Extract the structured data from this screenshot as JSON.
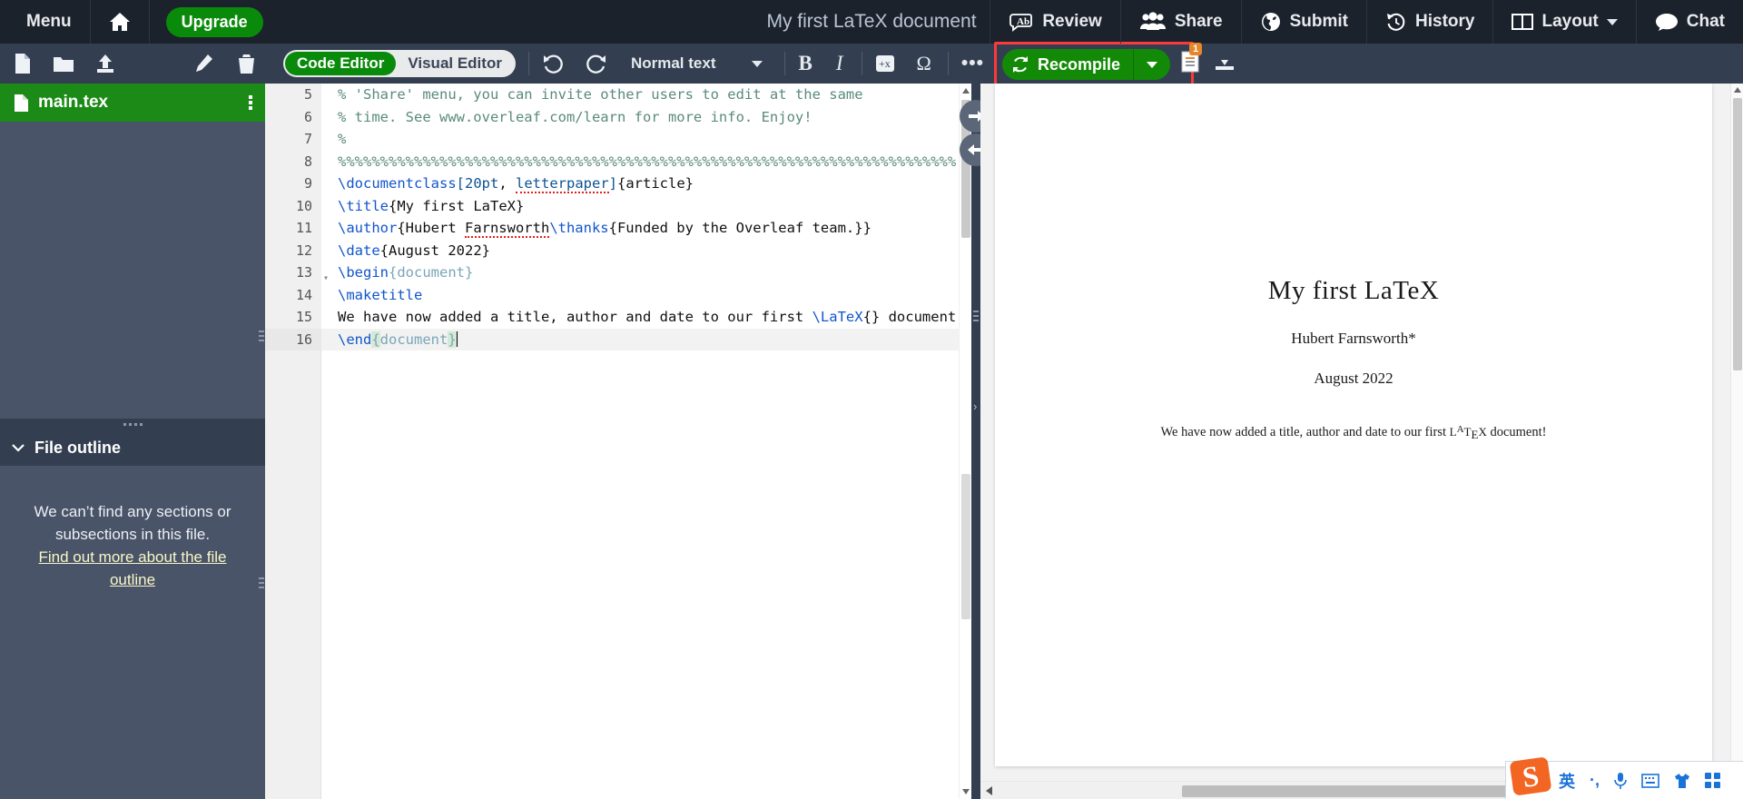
{
  "topbar": {
    "logo_icon": "overleaf-logo",
    "menu_label": "Menu",
    "home_icon": "home-icon",
    "upgrade_label": "Upgrade",
    "project_title": "My first LaTeX document",
    "review_label": "Review",
    "share_label": "Share",
    "submit_label": "Submit",
    "history_label": "History",
    "layout_label": "Layout",
    "chat_label": "Chat"
  },
  "toolbar": {
    "new_file_icon": "new-file-icon",
    "new_folder_icon": "new-folder-icon",
    "upload_icon": "upload-icon",
    "rename_icon": "pencil-icon",
    "delete_icon": "trash-icon",
    "code_editor_label": "Code Editor",
    "visual_editor_label": "Visual Editor",
    "undo_icon": "undo-icon",
    "redo_icon": "redo-icon",
    "text_style_label": "Normal text",
    "bold_label": "B",
    "italic_label": "I",
    "math_icon": "math-icon",
    "symbol_label": "Ω",
    "more_label": "•••",
    "search_icon": "search-icon",
    "recompile_label": "Recompile",
    "recompile_icon": "recompile-icon",
    "recompile_caret_icon": "chevron-down-icon",
    "logs_icon": "logs-icon",
    "logs_badge": "1",
    "download_icon": "download-icon",
    "highlight_color": "#fc3a3a",
    "accent_green": "#138a07"
  },
  "sidebar": {
    "file_name": "main.tex",
    "file_icon": "file-icon",
    "kebab_icon": "kebab-menu-icon",
    "outline_title": "File outline",
    "outline_chevron_icon": "chevron-down-icon",
    "outline_empty_line1": "We can’t find any sections or",
    "outline_empty_line2": "subsections in this file.",
    "outline_link": "Find out more about the file outline"
  },
  "editor": {
    "lines": [
      {
        "no": "5",
        "fold": false,
        "highlight": false,
        "tokens": [
          {
            "t": "% 'Share' menu, you can invite other users to edit at the same",
            "c": "tk-comment"
          }
        ]
      },
      {
        "no": "6",
        "fold": false,
        "highlight": false,
        "tokens": [
          {
            "t": "% time. See www.overleaf.com/learn for more info. Enjoy!",
            "c": "tk-comment"
          }
        ]
      },
      {
        "no": "7",
        "fold": false,
        "highlight": false,
        "tokens": [
          {
            "t": "%",
            "c": "tk-comment"
          }
        ]
      },
      {
        "no": "8",
        "fold": false,
        "highlight": false,
        "tokens": [
          {
            "t": "%%%%%%%%%%%%%%%%%%%%%%%%%%%%%%%%%%%%%%%%%%%%%%%%%%%%%%%%%%%%%%%%%%%%%%%%%",
            "c": "tk-comment"
          }
        ]
      },
      {
        "no": "9",
        "fold": false,
        "highlight": false,
        "tokens": [
          {
            "t": "\\documentclass",
            "c": "tk-cmd"
          },
          {
            "t": "[",
            "c": "tk-opt"
          },
          {
            "t": "20pt",
            "c": "tk-opt"
          },
          {
            "t": ", ",
            "c": "tk-plain"
          },
          {
            "t": "letterpaper",
            "c": "tk-opt spell"
          },
          {
            "t": "]",
            "c": "tk-opt"
          },
          {
            "t": "{article}",
            "c": "tk-plain"
          }
        ]
      },
      {
        "no": "10",
        "fold": false,
        "highlight": false,
        "tokens": [
          {
            "t": "\\title",
            "c": "tk-cmd"
          },
          {
            "t": "{My first LaTeX}",
            "c": "tk-plain"
          }
        ]
      },
      {
        "no": "11",
        "fold": false,
        "highlight": false,
        "tokens": [
          {
            "t": "\\author",
            "c": "tk-cmd"
          },
          {
            "t": "{Hubert ",
            "c": "tk-plain"
          },
          {
            "t": "Farnsworth",
            "c": "tk-plain spell"
          },
          {
            "t": "\\thanks",
            "c": "tk-cmd"
          },
          {
            "t": "{Funded by the Overleaf team.}}",
            "c": "tk-plain"
          }
        ]
      },
      {
        "no": "12",
        "fold": false,
        "highlight": false,
        "tokens": [
          {
            "t": "\\date",
            "c": "tk-cmd"
          },
          {
            "t": "{August 2022}",
            "c": "tk-plain"
          }
        ]
      },
      {
        "no": "13",
        "fold": true,
        "highlight": false,
        "tokens": [
          {
            "t": "\\begin",
            "c": "tk-cmd"
          },
          {
            "t": "{document}",
            "c": "tk-brace"
          }
        ]
      },
      {
        "no": "14",
        "fold": false,
        "highlight": false,
        "tokens": [
          {
            "t": "\\maketitle",
            "c": "tk-cmd"
          }
        ]
      },
      {
        "no": "15",
        "fold": false,
        "highlight": false,
        "tokens": [
          {
            "t": "We have now added a title, author and date to our first ",
            "c": "tk-plain"
          },
          {
            "t": "\\LaTeX",
            "c": "tk-cmd"
          },
          {
            "t": "{} document!",
            "c": "tk-plain"
          }
        ]
      },
      {
        "no": "16",
        "fold": false,
        "highlight": true,
        "tokens": [
          {
            "t": "\\end",
            "c": "tk-cmd"
          },
          {
            "t": "{",
            "c": "tk-brace brace-hl"
          },
          {
            "t": "document",
            "c": "tk-brace"
          },
          {
            "t": "}",
            "c": "tk-brace brace-hl"
          }
        ]
      }
    ]
  },
  "divider": {
    "collapse_right_icon": "arrow-right-icon",
    "collapse_left_icon": "arrow-left-icon"
  },
  "preview": {
    "title": "My first LaTeX",
    "author": "Hubert Farnsworth*",
    "date": "August 2022",
    "body_before": "We have now added a title, author and date to our first ",
    "body_logo_l": "L",
    "body_logo_a": "A",
    "body_logo_t": "T",
    "body_logo_e": "E",
    "body_logo_x": "X",
    "body_after": " document!"
  },
  "ime": {
    "logo_label": "S",
    "lang_label": "英",
    "punct_icon": "punctuation-icon",
    "mic_icon": "microphone-icon",
    "keyboard_icon": "keyboard-icon",
    "skin_icon": "skin-icon",
    "toolbox_icon": "toolbox-icon"
  }
}
